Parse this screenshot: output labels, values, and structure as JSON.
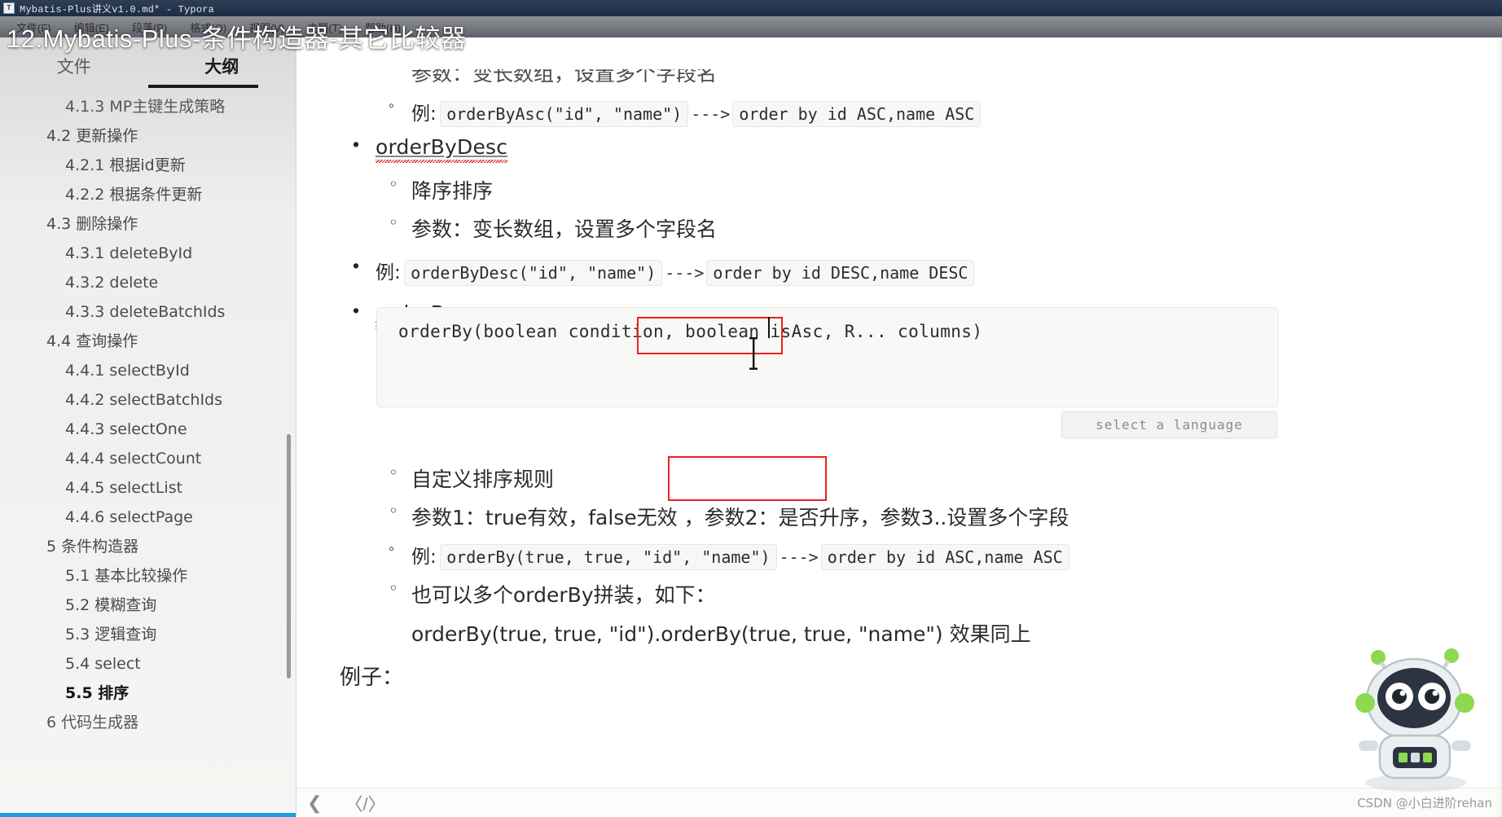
{
  "window": {
    "app_icon": "T",
    "title": "Mybatis-Plus讲义v1.0.md* - Typora",
    "menus": [
      "文件(F)",
      "编辑(E)",
      "段落(P)",
      "格式(O)",
      "视图(V)",
      "主题(T)",
      "帮助(H)"
    ]
  },
  "overlay": {
    "caption": "12.Mybatis-Plus-条件构造器-其它比较器"
  },
  "sidebar": {
    "tabs": [
      {
        "label": "文件",
        "active": false
      },
      {
        "label": "大纲",
        "active": true
      }
    ],
    "items": [
      {
        "label": "4.1.3 MP主键生成策略",
        "level": 2,
        "active": false
      },
      {
        "label": "4.2 更新操作",
        "level": 1,
        "active": false
      },
      {
        "label": "4.2.1 根据id更新",
        "level": 2,
        "active": false
      },
      {
        "label": "4.2.2 根据条件更新",
        "level": 2,
        "active": false
      },
      {
        "label": "4.3 删除操作",
        "level": 1,
        "active": false
      },
      {
        "label": "4.3.1 deleteById",
        "level": 2,
        "active": false
      },
      {
        "label": "4.3.2 delete",
        "level": 2,
        "active": false
      },
      {
        "label": "4.3.3 deleteBatchIds",
        "level": 2,
        "active": false
      },
      {
        "label": "4.4 查询操作",
        "level": 1,
        "active": false
      },
      {
        "label": "4.4.1 selectById",
        "level": 2,
        "active": false
      },
      {
        "label": "4.4.2 selectBatchIds",
        "level": 2,
        "active": false
      },
      {
        "label": "4.4.3 selectOne",
        "level": 2,
        "active": false
      },
      {
        "label": "4.4.4 selectCount",
        "level": 2,
        "active": false
      },
      {
        "label": "4.4.5 selectList",
        "level": 2,
        "active": false
      },
      {
        "label": "4.4.6 selectPage",
        "level": 2,
        "active": false
      },
      {
        "label": "5 条件构造器",
        "level": 1,
        "active": false
      },
      {
        "label": "5.1 基本比较操作",
        "level": 2,
        "active": false
      },
      {
        "label": "5.2 模糊查询",
        "level": 2,
        "active": false
      },
      {
        "label": "5.3 逻辑查询",
        "level": 2,
        "active": false
      },
      {
        "label": "5.4 select",
        "level": 2,
        "active": false
      },
      {
        "label": "5.5 排序",
        "level": 2,
        "active": true
      },
      {
        "label": "6 代码生成器",
        "level": 1,
        "active": false
      }
    ]
  },
  "document": {
    "line_top_partial": "参数：变长数组，设置多个字段名",
    "example_asc": {
      "prefix": "例:",
      "code": "orderByAsc(\"id\", \"name\")",
      "arrow": "--->",
      "result": "order by id ASC,name ASC"
    },
    "heading_order_by_desc": "orderByDesc",
    "desc_bullets": [
      "降序排序",
      "参数：变长数组，设置多个字段名"
    ],
    "example_desc": {
      "prefix": "例:",
      "code": "orderByDesc(\"id\", \"name\")",
      "arrow": "--->",
      "result": "order by id DESC,name DESC"
    },
    "heading_order_by": "orderBy",
    "codeblock": {
      "text": "orderBy(boolean condition, boolean isAsc, R... columns)",
      "language_placeholder": "select a language"
    },
    "order_by_bullets": [
      "自定义排序规则",
      "参数1：true有效，false无效 ，参数2：是否升序，参数3..设置多个字段"
    ],
    "example_orderby": {
      "prefix": "例:",
      "code": "orderBy(true, true, \"id\", \"name\")",
      "arrow": "--->",
      "result": "order by id ASC,name ASC"
    },
    "chain_note": "也可以多个orderBy拼装，如下：",
    "chain_code": "orderBy(true, true, \"id\").orderBy(true, true, \"name\") 效果同上",
    "example_label": "例子："
  },
  "bottom_bar": {
    "collapse_icon": "chevron-left",
    "source_icon": "code"
  },
  "watermark": {
    "text": "CSDN @小白进阶rehan"
  },
  "colors": {
    "accent_red": "#ef2020",
    "accent_blue": "#1b9fe0",
    "titlebar": "#2c3e58"
  }
}
